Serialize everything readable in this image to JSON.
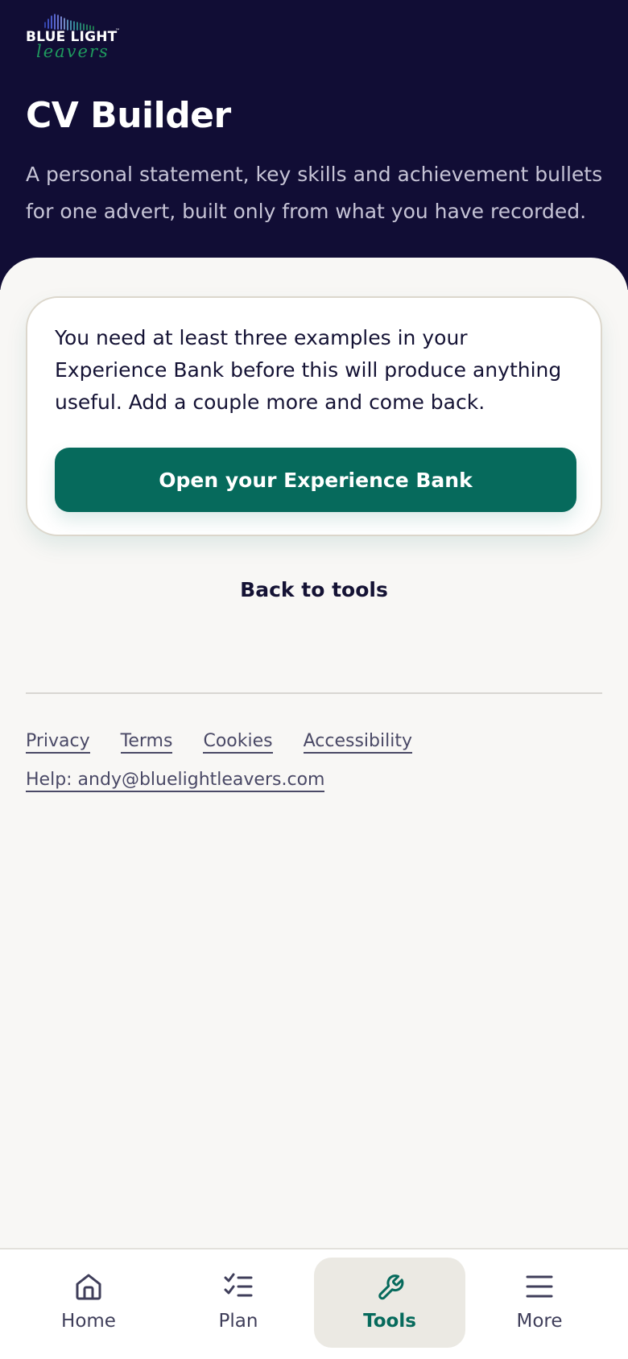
{
  "brand": {
    "logo_top": "BLUE LIGHT",
    "logo_script": "leavers",
    "logo_tm": "™"
  },
  "header": {
    "title": "CV Builder",
    "subtitle": "A personal statement, key skills and achievement bullets for one advert, built only from what you have recorded."
  },
  "notice": {
    "message": "You need at least three examples in your Experience Bank before this will produce anything useful. Add a couple more and come back.",
    "button_label": "Open your Experience Bank"
  },
  "back_link": "Back to tools",
  "footer": {
    "links": [
      "Privacy",
      "Terms",
      "Cookies",
      "Accessibility"
    ],
    "help": "Help: andy@bluelightleavers.com"
  },
  "nav": {
    "items": [
      {
        "label": "Home",
        "icon": "home-icon",
        "active": false
      },
      {
        "label": "Plan",
        "icon": "checklist-icon",
        "active": false
      },
      {
        "label": "Tools",
        "icon": "wrench-icon",
        "active": true
      },
      {
        "label": "More",
        "icon": "menu-icon",
        "active": false
      }
    ]
  },
  "colors": {
    "header_bg": "#110d35",
    "accent": "#066a5c",
    "logo_green": "#1f9a5e",
    "page_bg": "#f8f7f5"
  }
}
